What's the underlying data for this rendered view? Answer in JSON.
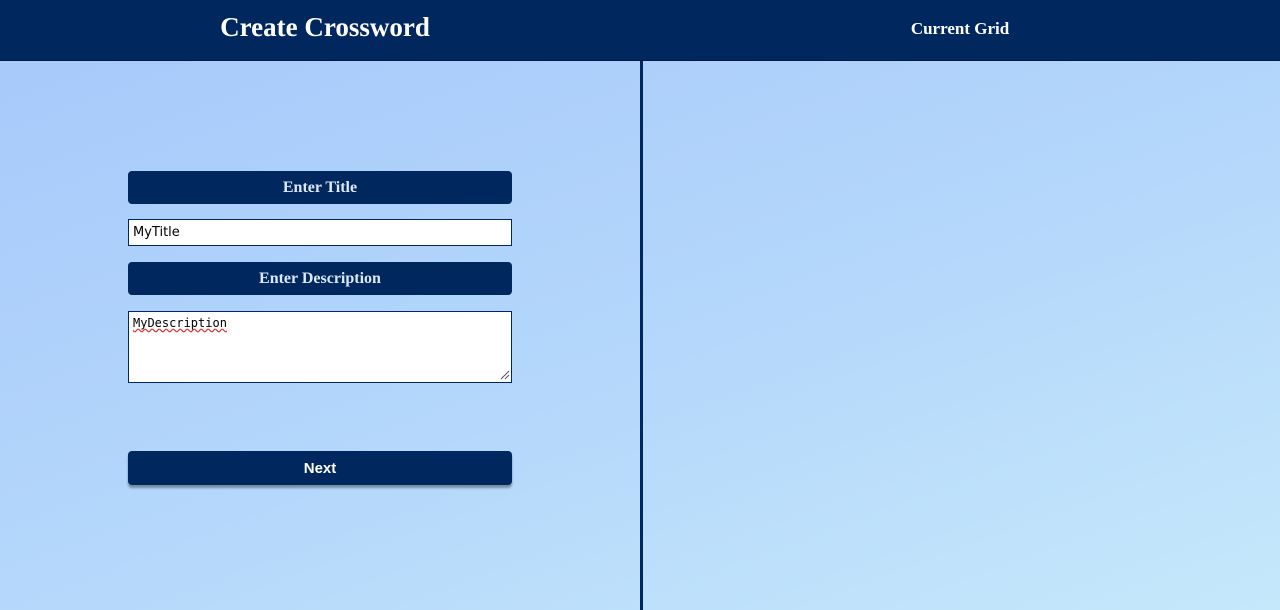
{
  "header": {
    "app_title": "Create Crossword",
    "grid_title": "Current Grid"
  },
  "form": {
    "title_label": "Enter Title",
    "title_value": "MyTitle",
    "description_label": "Enter Description",
    "description_value": "MyDescription",
    "next_label": "Next"
  },
  "colors": {
    "primary": "#00285e",
    "label_text": "#dce8f8",
    "background_start": "#a6c8fb",
    "background_end": "#c6e8fb"
  }
}
